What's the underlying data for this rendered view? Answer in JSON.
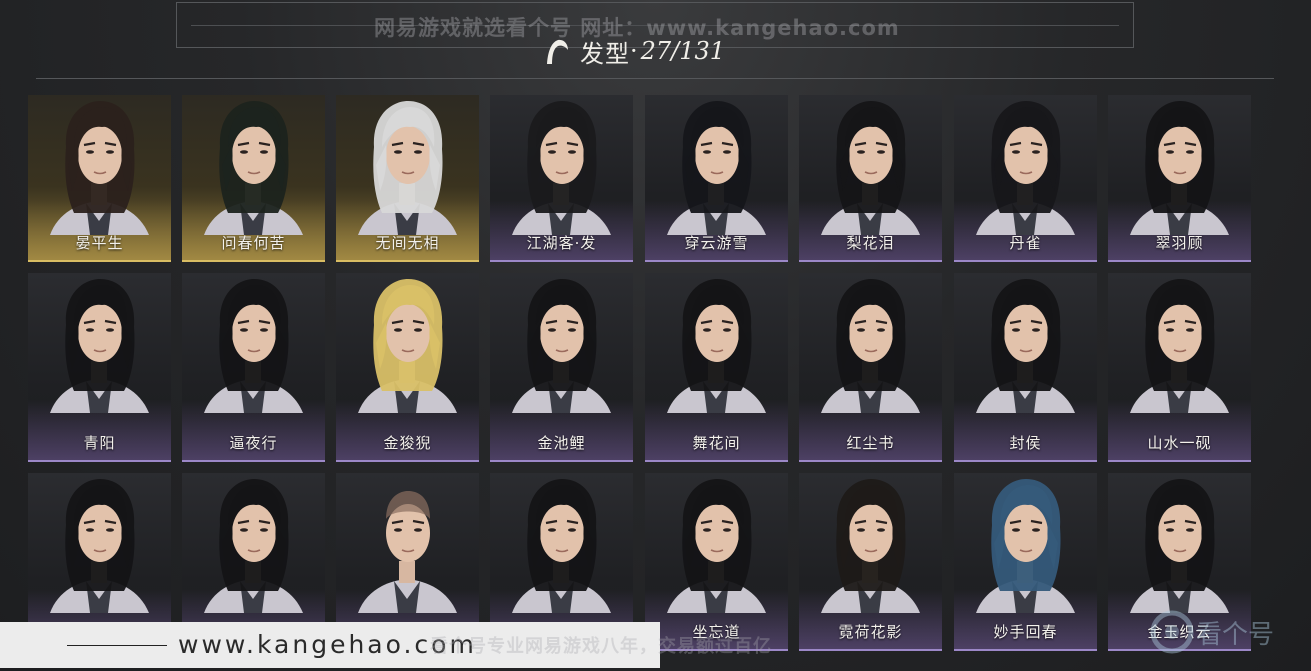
{
  "watermark_top": "网易游戏就选看个号  网址：www.kangehao.com",
  "title": {
    "label": "发型",
    "separator": "·",
    "count": "27/131"
  },
  "hairstyles": [
    [
      {
        "name": "晏平生",
        "hair": "#2b211c",
        "style": "gold"
      },
      {
        "name": "问春何苦",
        "hair": "#1c231e",
        "style": "gold"
      },
      {
        "name": "无间无相",
        "hair": "#d8d8d8",
        "style": "gold"
      },
      {
        "name": "江湖客·发",
        "hair": "#1a1a1c",
        "style": "purple"
      },
      {
        "name": "穿云游雪",
        "hair": "#15161a",
        "style": "purple"
      },
      {
        "name": "梨花泪",
        "hair": "#151517",
        "style": "purple"
      },
      {
        "name": "丹雀",
        "hair": "#17171a",
        "style": "purple"
      },
      {
        "name": "翠羽顾",
        "hair": "#141416",
        "style": "purple"
      }
    ],
    [
      {
        "name": "青阳",
        "hair": "#141416",
        "style": "purple"
      },
      {
        "name": "逼夜行",
        "hair": "#141416",
        "style": "purple"
      },
      {
        "name": "金狻猊",
        "hair": "#d9c067",
        "style": "purple"
      },
      {
        "name": "金池鲤",
        "hair": "#141416",
        "style": "purple"
      },
      {
        "name": "舞花间",
        "hair": "#141416",
        "style": "purple"
      },
      {
        "name": "红尘书",
        "hair": "#141416",
        "style": "purple"
      },
      {
        "name": "封侯",
        "hair": "#141416",
        "style": "purple"
      },
      {
        "name": "山水一砚",
        "hair": "#141416",
        "style": "purple"
      }
    ],
    [
      {
        "name": "",
        "hair": "#141416",
        "style": "purple"
      },
      {
        "name": "",
        "hair": "#141416",
        "style": "purple"
      },
      {
        "name": "",
        "hair": "#5a4a40",
        "style": "purple"
      },
      {
        "name": "",
        "hair": "#141416",
        "style": "purple"
      },
      {
        "name": "坐忘道",
        "hair": "#141416",
        "style": "purple"
      },
      {
        "name": "霓荷花影",
        "hair": "#1e1a18",
        "style": "purple"
      },
      {
        "name": "妙手回春",
        "hair": "#355a7a",
        "style": "purple"
      },
      {
        "name": "金玉织云",
        "hair": "#141416",
        "style": "purple"
      }
    ]
  ],
  "watermark_bottom": {
    "url": "www.kangehao.com",
    "mid": "看个号专业网易游戏八年，交易额过百亿",
    "logo": "看个号"
  },
  "colors": {
    "gold": "#d9bd63",
    "purple": "#9c88c8"
  }
}
